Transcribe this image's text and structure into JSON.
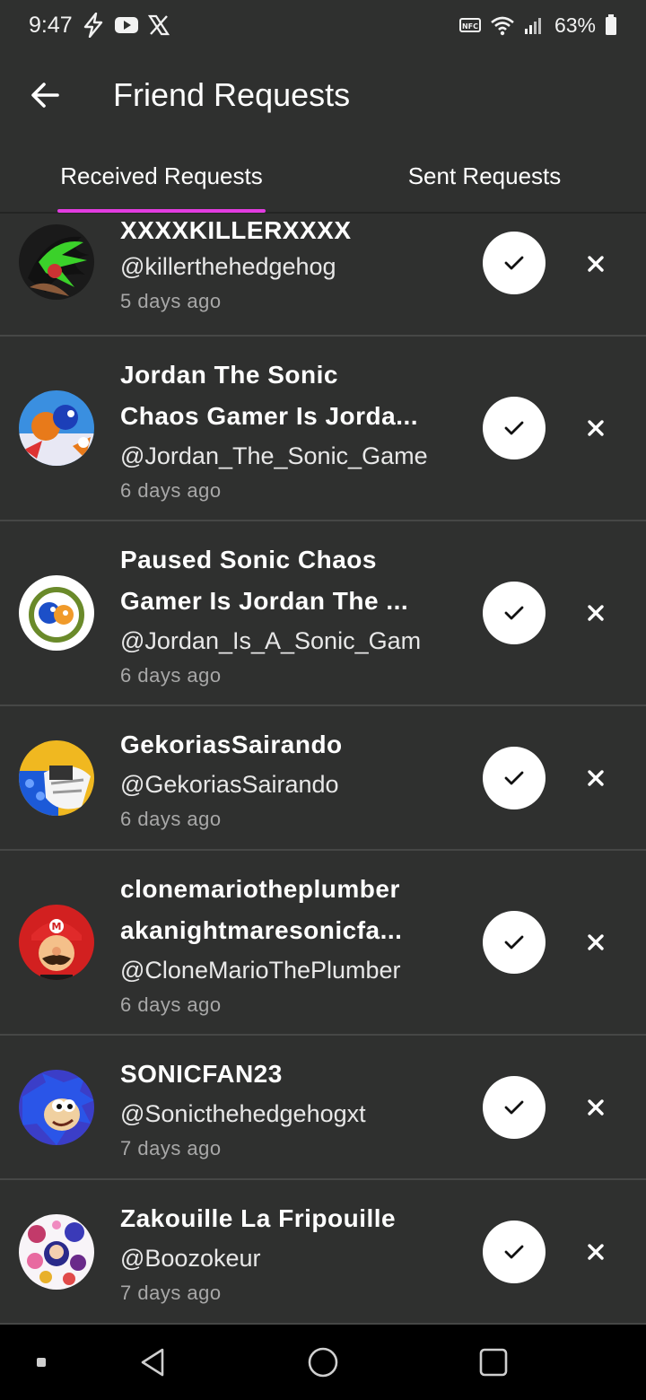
{
  "status_bar": {
    "time": "9:47",
    "battery": "63%"
  },
  "header": {
    "title": "Friend Requests"
  },
  "tabs": [
    {
      "label": "Received Requests",
      "active": true
    },
    {
      "label": "Sent Requests",
      "active": false
    }
  ],
  "requests": [
    {
      "name": "XXXXKILLERXXXX",
      "handle": "@killerthehedgehog",
      "time": "5 days ago"
    },
    {
      "name_line1": "Jordan The Sonic",
      "name_line2": "Chaos Gamer Is Jorda...",
      "handle": "@Jordan_The_Sonic_Game",
      "time": "6 days ago"
    },
    {
      "name_line1": "Paused Sonic Chaos",
      "name_line2": "Gamer Is Jordan The ...",
      "handle": "@Jordan_Is_A_Sonic_Gam",
      "time": "6 days ago"
    },
    {
      "name": "GekoriasSairando",
      "handle": "@GekoriasSairando",
      "time": "6 days ago"
    },
    {
      "name_line1": "clonemariotheplumber",
      "name_line2": "akanightmaresonicfa...",
      "handle": "@CloneMarioThePlumber",
      "time": "6 days ago"
    },
    {
      "name": "SONICFAN23",
      "handle": "@Sonicthehedgehogxt",
      "time": "7 days ago"
    },
    {
      "name": "Zakouille La Fripouille",
      "handle": "@Boozokeur",
      "time": "7 days ago"
    }
  ],
  "icons": {
    "back": "arrow-left-icon",
    "accept": "check-icon",
    "reject": "close-icon",
    "nav": [
      "recents-icon",
      "back-triangle-icon",
      "home-circle-icon",
      "overview-square-icon"
    ]
  },
  "colors": {
    "background": "#2f302f",
    "tab_indicator": "#e23ce0",
    "divider": "#464746"
  }
}
